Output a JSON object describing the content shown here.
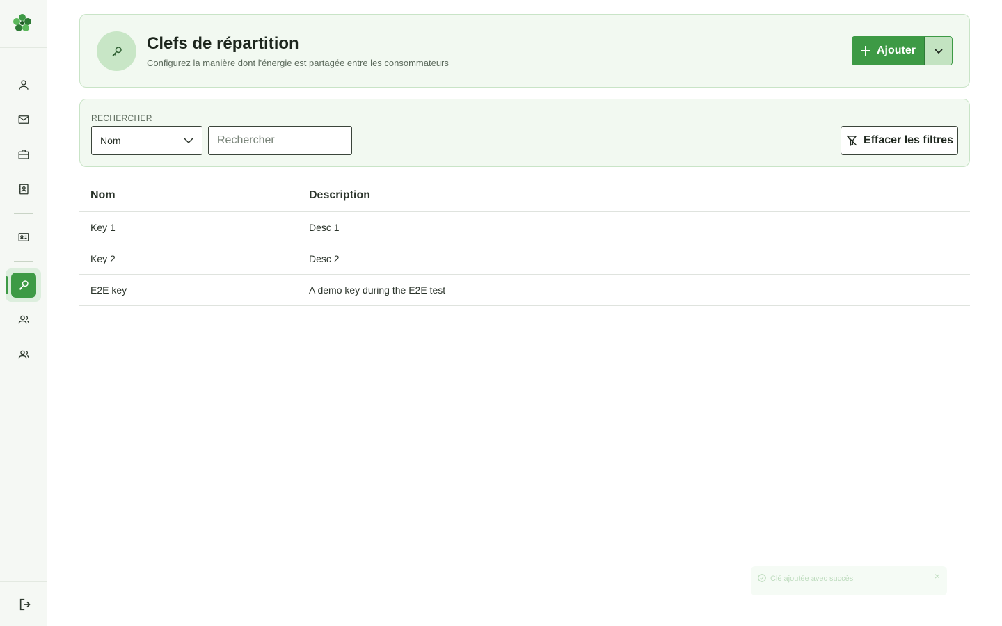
{
  "colors": {
    "accent": "#3d9a45",
    "card_bg": "#f2f9f1",
    "card_border": "#c9e4c7"
  },
  "sidebar": {
    "logo": "clover-logo",
    "items": [
      {
        "icon": "user-icon"
      },
      {
        "icon": "mail-icon"
      },
      {
        "icon": "briefcase-icon"
      },
      {
        "icon": "contact-book-icon"
      },
      {
        "icon": "id-card-icon"
      },
      {
        "icon": "key-icon",
        "active": true
      },
      {
        "icon": "users-icon"
      },
      {
        "icon": "users-icon"
      }
    ],
    "logout_icon": "logout-icon"
  },
  "header": {
    "icon": "key-icon",
    "title": "Clefs de répartition",
    "subtitle": "Configurez la manière dont l'énergie est partagée entre les consommateurs",
    "add_label": "Ajouter"
  },
  "filters": {
    "label": "RECHERCHER",
    "field_selected": "Nom",
    "search_placeholder": "Rechercher",
    "search_value": "",
    "clear_label": "Effacer les filtres"
  },
  "table": {
    "columns": [
      "Nom",
      "Description"
    ],
    "rows": [
      {
        "name": "Key 1",
        "description": "Desc 1"
      },
      {
        "name": "Key 2",
        "description": "Desc 2"
      },
      {
        "name": "E2E key",
        "description": "A demo key during the E2E test"
      }
    ]
  },
  "toast": {
    "message": "Clé ajoutée avec succès",
    "close": "×"
  }
}
